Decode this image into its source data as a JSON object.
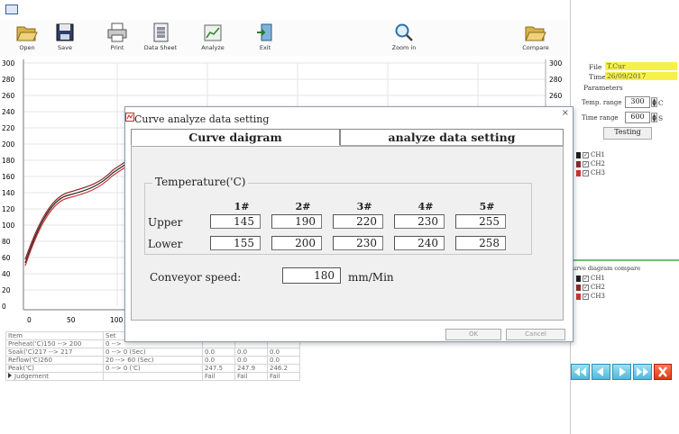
{
  "toolbar": {
    "open": "Open",
    "save": "Save",
    "print": "Print",
    "data_sheet": "Data Sheet",
    "analyze": "Analyze",
    "exit": "Exit",
    "zoom_in": "Zoom in",
    "compare": "Compare"
  },
  "chart": {
    "y_ticks_left": [
      "300",
      "280",
      "260",
      "240",
      "220",
      "200",
      "180",
      "160",
      "140",
      "120",
      "100",
      "80",
      "60",
      "40",
      "20",
      "0"
    ],
    "y_ticks_right": [
      "300",
      "280",
      "260"
    ],
    "x_ticks": [
      "0",
      "50",
      "100"
    ]
  },
  "right_panel": {
    "file_label": "File",
    "file_value": "T.Cur",
    "time_label": "Time",
    "time_value": "26/09/2017",
    "parameters_label": "Parameters",
    "temp_range_label": "Temp. range",
    "temp_range_value": "300",
    "temp_unit": "C",
    "time_range_label": "Time range",
    "time_range_value": "600",
    "time_unit": "S",
    "testing_button": "Testing",
    "channels": [
      "CH1",
      "CH2",
      "CH3"
    ],
    "compare_title": "urve diagram compare",
    "compare_channels": [
      "CH1",
      "CH2",
      "CH3"
    ],
    "channel_colors": [
      "#202020",
      "#8b2a2a",
      "#d03030"
    ]
  },
  "results_table": {
    "headers": [
      "Item",
      "Set"
    ],
    "rows": [
      [
        "Preheat('C)150 --> 200",
        "0 -->",
        "",
        "",
        ""
      ],
      [
        "Soak('C)217 --> 217",
        "0 --> 0 (Sec)",
        "0.0",
        "0.0",
        "0.0"
      ],
      [
        "Reflow('C)260",
        "20 --> 60 (Sec)",
        "0.0",
        "0.0",
        "0.0"
      ],
      [
        "Peak('C)",
        "0 --> 0 ('C)",
        "247.5",
        "247.9",
        "246.2"
      ],
      [
        "Judgement",
        "",
        "Fail",
        "Fail",
        "Fail"
      ]
    ]
  },
  "dialog": {
    "title": "Curve analyze data setting",
    "tab_curve": "Curve daigram",
    "tab_analyze": "analyze data setting",
    "group_label": "Temperature('C)",
    "columns": [
      "1#",
      "2#",
      "3#",
      "4#",
      "5#"
    ],
    "upper_label": "Upper",
    "upper_values": [
      "145",
      "190",
      "220",
      "230",
      "255"
    ],
    "lower_label": "Lower",
    "lower_values": [
      "155",
      "200",
      "230",
      "240",
      "258"
    ],
    "speed_label": "Conveyor speed:",
    "speed_value": "180",
    "speed_unit": "mm/Min",
    "ok_button": "OK",
    "cancel_button": "Cancel"
  }
}
